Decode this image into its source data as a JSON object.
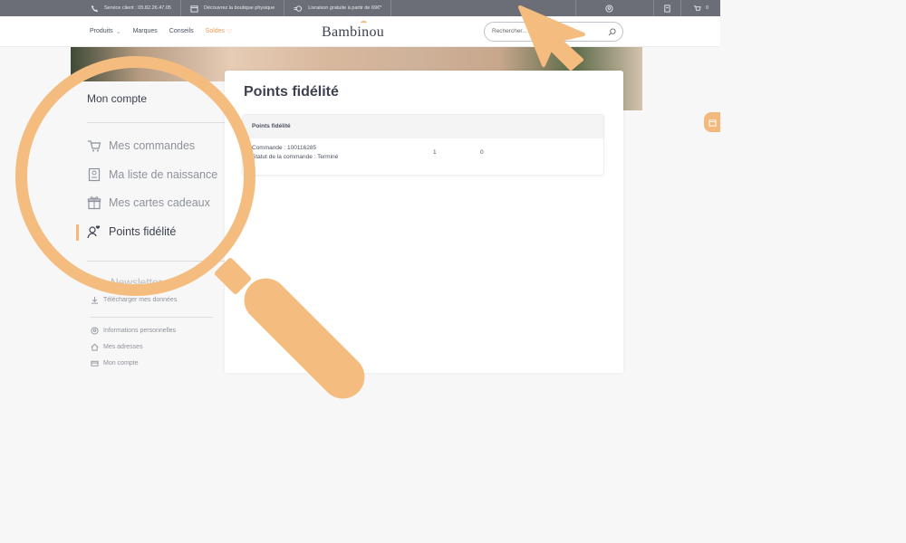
{
  "topbar": {
    "service": "Service client : 05.82.26.47.05",
    "boutique": "Découvrez la boutique physique",
    "livraison": "Livraison gratuite à partir de 69€*",
    "cart_count": "0"
  },
  "header": {
    "nav": [
      "Produits",
      "Marques",
      "Conseils",
      "Soldes"
    ],
    "logo": "Bambinou",
    "search_placeholder": "Rechercher..."
  },
  "sidebar": {
    "title": "Mon compte",
    "items": [
      {
        "label": "Mes commandes",
        "icon": "cart-icon"
      },
      {
        "label": "Ma liste de naissance",
        "icon": "list-icon"
      },
      {
        "label": "Mes cartes cadeaux",
        "icon": "gift-icon"
      },
      {
        "label": "Points fidélité",
        "icon": "loyalty-icon"
      }
    ],
    "newsletter": "Newsletter",
    "download": "Télécharger mes données",
    "small_items": [
      "Informations personnelles",
      "Mes adresses",
      "Mon compte"
    ]
  },
  "main": {
    "title": "Points fidélité",
    "table_header": "Points fidélité",
    "row": {
      "order": "Commande : 100116285",
      "status": "Statut de la commande : Terminé",
      "col1": "1",
      "col2": "0"
    }
  },
  "colors": {
    "accent": "#f4bd7f",
    "topbar": "#6b6e76",
    "sale": "#f29a5b"
  }
}
